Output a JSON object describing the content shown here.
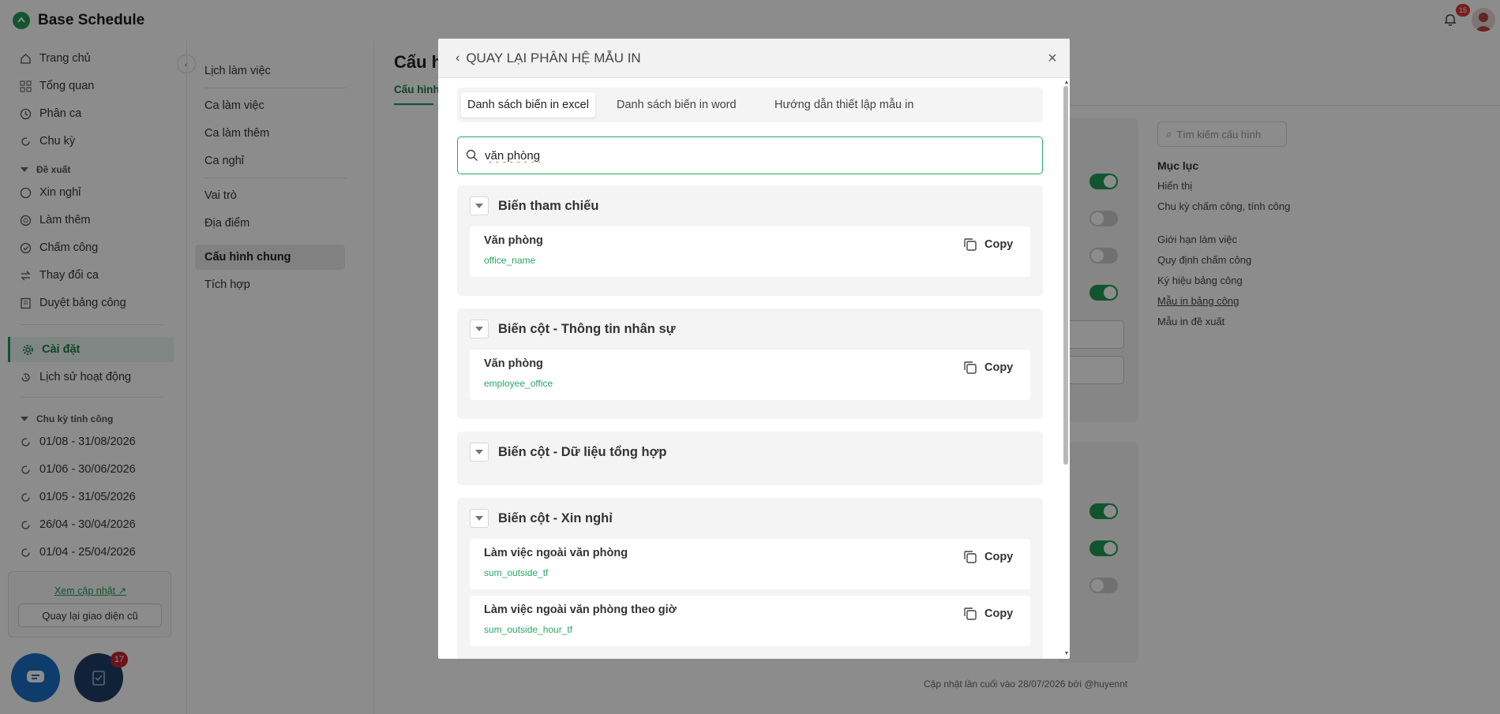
{
  "app": {
    "title": "Base Schedule",
    "notification_count": "15"
  },
  "sidebar": {
    "items": [
      {
        "label": "Trang chủ",
        "icon": "home-icon"
      },
      {
        "label": "Tổng quan",
        "icon": "dashboard-icon"
      },
      {
        "label": "Phân ca",
        "icon": "clock-icon"
      },
      {
        "label": "Chu kỳ",
        "icon": "refresh-icon"
      }
    ],
    "section_proposal": "Đề xuất",
    "proposal_items": [
      {
        "label": "Xin nghỉ",
        "icon": "leave-icon"
      },
      {
        "label": "Làm thêm",
        "icon": "overtime-icon"
      },
      {
        "label": "Chấm công",
        "icon": "checkin-icon"
      },
      {
        "label": "Thay đổi ca",
        "icon": "swap-icon"
      },
      {
        "label": "Duyệt bảng công",
        "icon": "approve-icon"
      }
    ],
    "settings": "Cài đặt",
    "history": "Lịch sử hoạt động",
    "section_cycles": "Chu kỳ tính công",
    "cycles": [
      "01/08 - 31/08/2026",
      "01/06 - 30/06/2026",
      "01/05 - 31/05/2026",
      "26/04 - 30/04/2026",
      "01/04 - 25/04/2026"
    ],
    "see_updates": "Xem cập nhật",
    "old_ui_button": "Quay lại giao diện cũ",
    "task_badge": "17"
  },
  "subnav": {
    "items": [
      "Lịch làm việc",
      "Ca làm việc",
      "Ca làm thêm",
      "Ca nghỉ",
      "Vai trò",
      "Địa điểm",
      "Cấu hình chung",
      "Tích hợp"
    ],
    "active": "Cấu hình chung"
  },
  "main": {
    "title": "Cấu h",
    "tab": "Cấu hình",
    "footnote": "Cập nhật lần cuối vào 28/07/2026 bởi @huyennt"
  },
  "toc": {
    "search_placeholder": "Tìm kiếm cấu hình",
    "title": "Mục lục",
    "items": [
      "Hiển thị",
      "Chu kỳ chấm công, tính công",
      "Giới hạn làm việc",
      "Quy định chấm công",
      "Ký hiệu bảng công",
      "Mẫu in bảng công",
      "Mẫu in đề xuất"
    ]
  },
  "modal": {
    "back_label": "QUAY LẠI PHÂN HỆ MẪU IN",
    "close": "×",
    "tabs": [
      "Danh sách biến in excel",
      "Danh sách biến in word",
      "Hướng dẫn thiết lập mẫu in"
    ],
    "active_tab": "Danh sách biến in excel",
    "search_value": "văn phòng",
    "copy_label": "Copy",
    "groups": [
      {
        "title": "Biến tham chiếu",
        "vars": [
          {
            "name": "Văn phòng",
            "code": "office_name"
          }
        ]
      },
      {
        "title": "Biến cột - Thông tin nhân sự",
        "vars": [
          {
            "name": "Văn phòng",
            "code": "employee_office"
          }
        ]
      },
      {
        "title": "Biến cột - Dữ liệu tổng hợp",
        "vars": []
      },
      {
        "title": "Biến cột - Xin nghỉ",
        "vars": [
          {
            "name": "Làm việc ngoài văn phòng",
            "code": "sum_outside_tf"
          },
          {
            "name": "Làm việc ngoài văn phòng theo giờ",
            "code": "sum_outside_hour_tf"
          }
        ]
      }
    ]
  },
  "colors": {
    "accent": "#1f9b57",
    "code_green": "#2aa865",
    "overlay": "rgba(0,0,0,0.45)"
  }
}
